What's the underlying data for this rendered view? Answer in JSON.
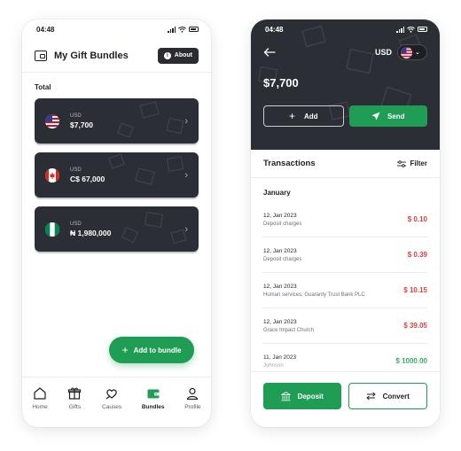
{
  "left": {
    "time": "04:48",
    "title": "My Gift Bundles",
    "about_label": "About",
    "total_label": "Total",
    "bundles": [
      {
        "currency": "USD",
        "amount": "$7,700",
        "flag": "us-flag-icon"
      },
      {
        "currency": "USD",
        "amount": "C$ 67,000",
        "flag": "ca-flag-icon"
      },
      {
        "currency": "USD",
        "amount": "₦ 1,980,000",
        "flag": "ng-flag-icon"
      }
    ],
    "add_bundle_label": "Add to bundle",
    "tabs": [
      {
        "label": "Home",
        "icon": "home-icon"
      },
      {
        "label": "Gifts",
        "icon": "gift-icon"
      },
      {
        "label": "Causes",
        "icon": "causes-icon"
      },
      {
        "label": "Bundles",
        "icon": "wallet-icon",
        "active": true
      },
      {
        "label": "Profile",
        "icon": "profile-icon"
      }
    ]
  },
  "right": {
    "time": "04:48",
    "currency": "USD",
    "balance": "$7,700",
    "add_label": "Add",
    "send_label": "Send",
    "transactions_title": "Transactions",
    "filter_label": "Filter",
    "month": "January",
    "transactions": [
      {
        "date": "12, Jan 2023",
        "desc": "Deposit charges",
        "amount": "$ 0.10",
        "type": "debit"
      },
      {
        "date": "12, Jan 2023",
        "desc": "Deposit charges",
        "amount": "$ 0.39",
        "type": "debit"
      },
      {
        "date": "12, Jan 2023",
        "desc": "Human services, Guaranty Trust Bank PLC",
        "amount": "$ 10.15",
        "type": "debit"
      },
      {
        "date": "12, Jan 2023",
        "desc": "Grace Impact Church",
        "amount": "$ 39.05",
        "type": "debit"
      },
      {
        "date": "11, Jan 2023",
        "desc": "Johnson",
        "amount": "$ 1000.00",
        "type": "credit"
      }
    ],
    "deposit_label": "Deposit",
    "convert_label": "Convert"
  },
  "colors": {
    "accent": "#1f9d55",
    "dark": "#2c2e35",
    "debit": "#d64545"
  }
}
